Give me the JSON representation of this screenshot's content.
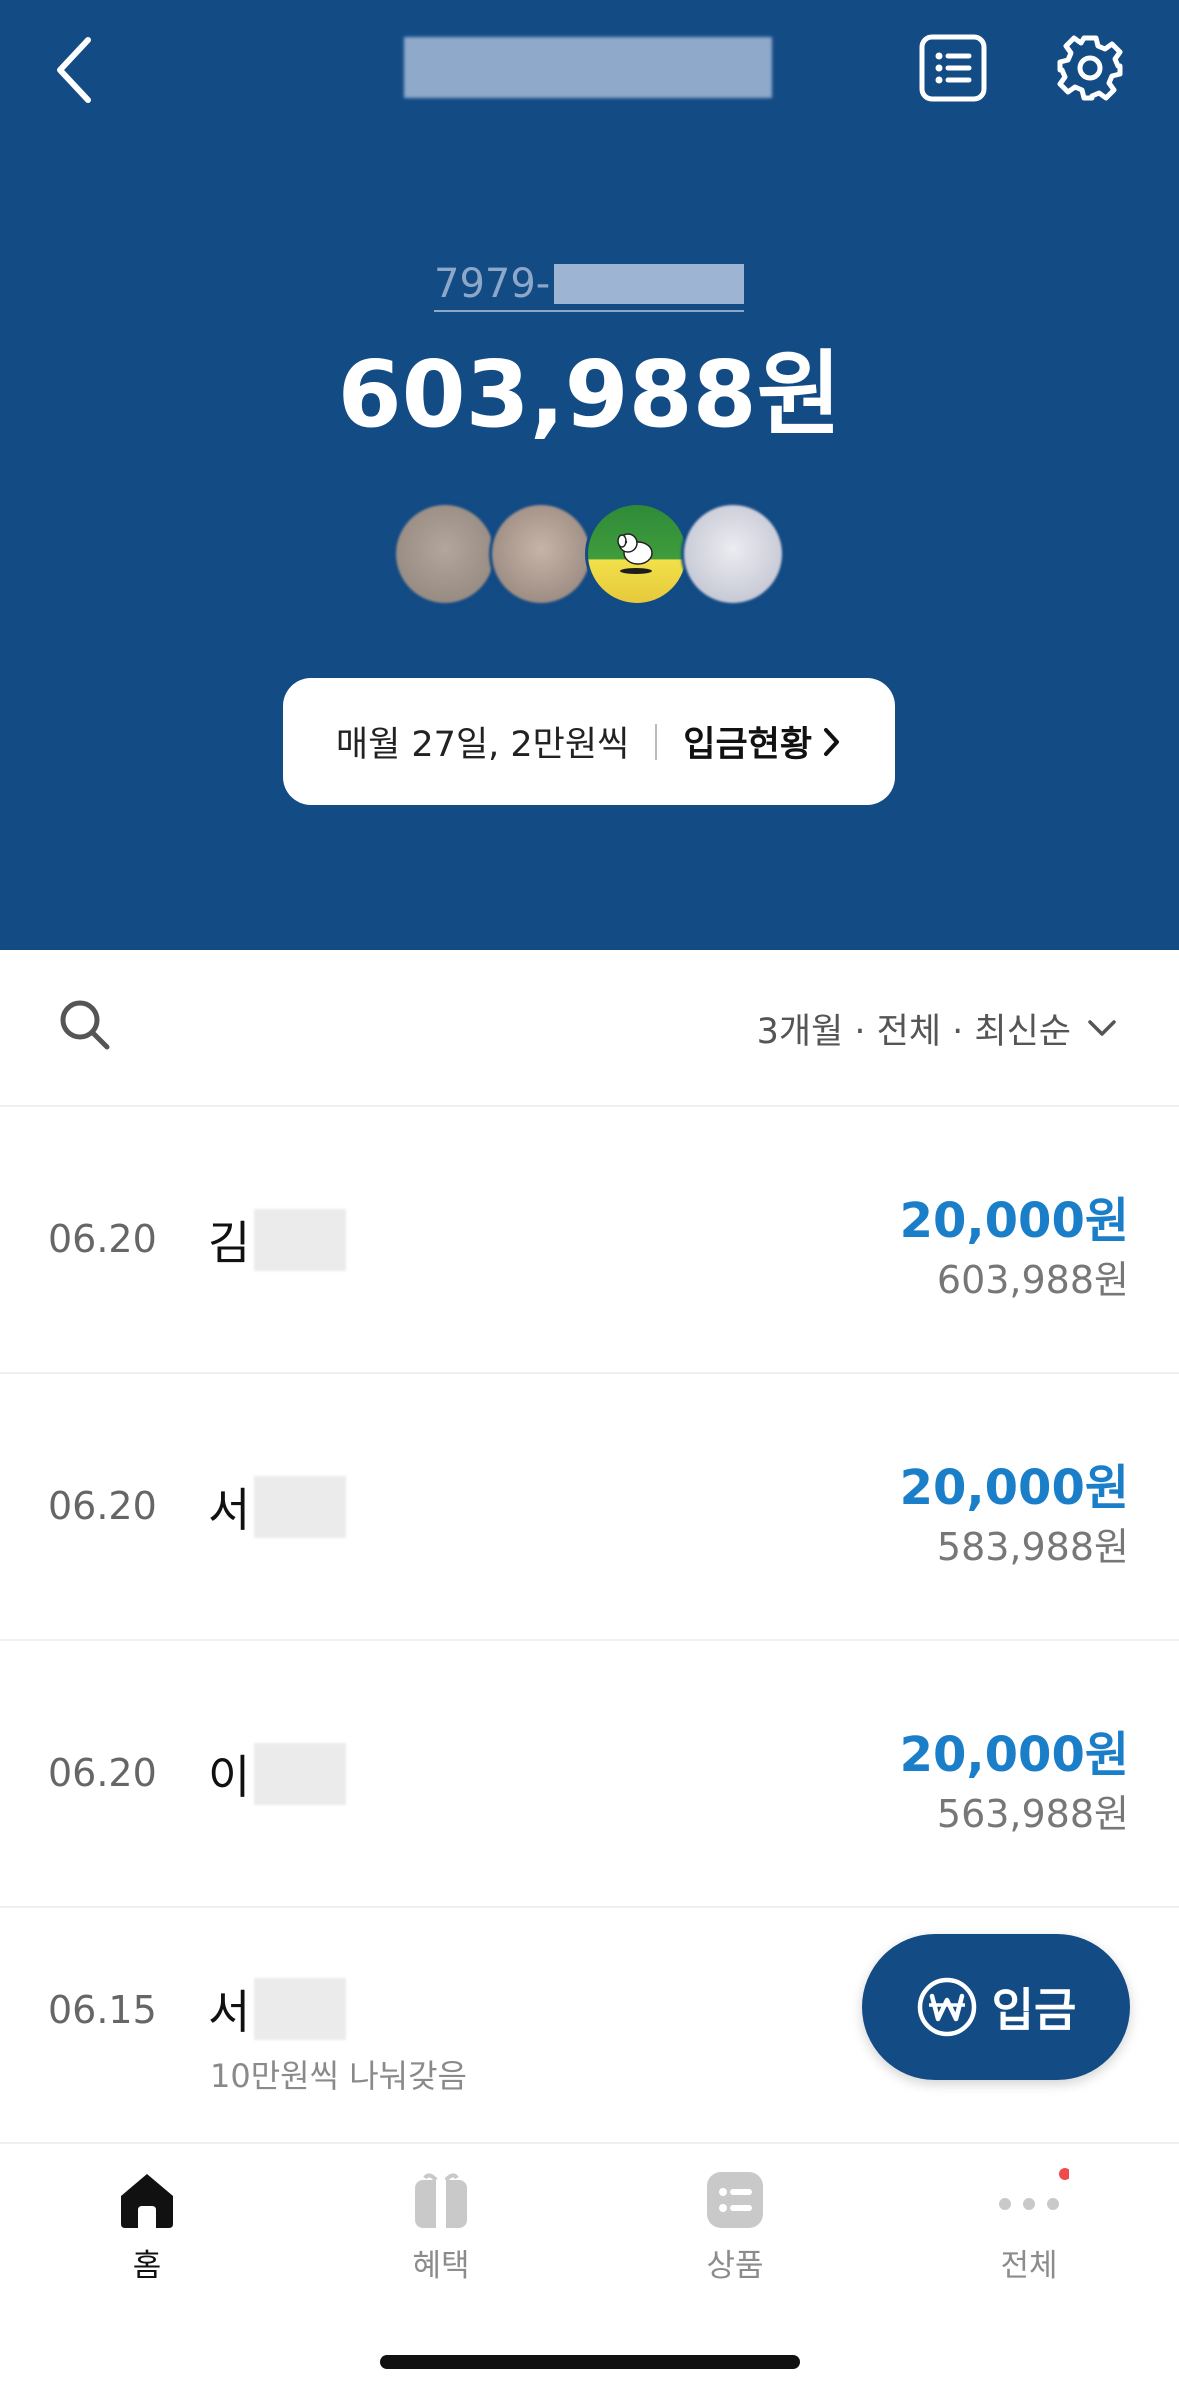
{
  "header": {
    "back_icon": "chevron-left-icon",
    "history_icon": "list-icon",
    "settings_icon": "gear-icon",
    "account_prefix": "7979-",
    "balance": "603,988원",
    "deposit_rule": "매월 27일, 2만원씩",
    "deposit_status_label": "입금현황",
    "background": "#134b85"
  },
  "filter": {
    "search_icon": "search-icon",
    "label": "3개월 · 전체 · 최신순"
  },
  "transactions": [
    {
      "date": "06.20",
      "name": "김",
      "amount": "20,000원",
      "balance": "603,988원",
      "memo": ""
    },
    {
      "date": "06.20",
      "name": "서",
      "amount": "20,000원",
      "balance": "583,988원",
      "memo": ""
    },
    {
      "date": "06.20",
      "name": "이",
      "amount": "20,000원",
      "balance": "563,988원",
      "memo": ""
    },
    {
      "date": "06.15",
      "name": "서",
      "amount": "",
      "balance": "",
      "memo": "10만원씩 나눠갖음"
    }
  ],
  "fab": {
    "label": "입금",
    "icon": "won-icon"
  },
  "tabs": [
    {
      "label": "홈",
      "icon": "home-icon",
      "active": true
    },
    {
      "label": "혜택",
      "icon": "gift-icon",
      "active": false
    },
    {
      "label": "상품",
      "icon": "product-list-icon",
      "active": false
    },
    {
      "label": "전체",
      "icon": "more-dots-icon",
      "active": false
    }
  ],
  "colors": {
    "accent_amount": "#1a7ec9",
    "primary": "#134b85",
    "notification_dot": "#f04b4b"
  }
}
